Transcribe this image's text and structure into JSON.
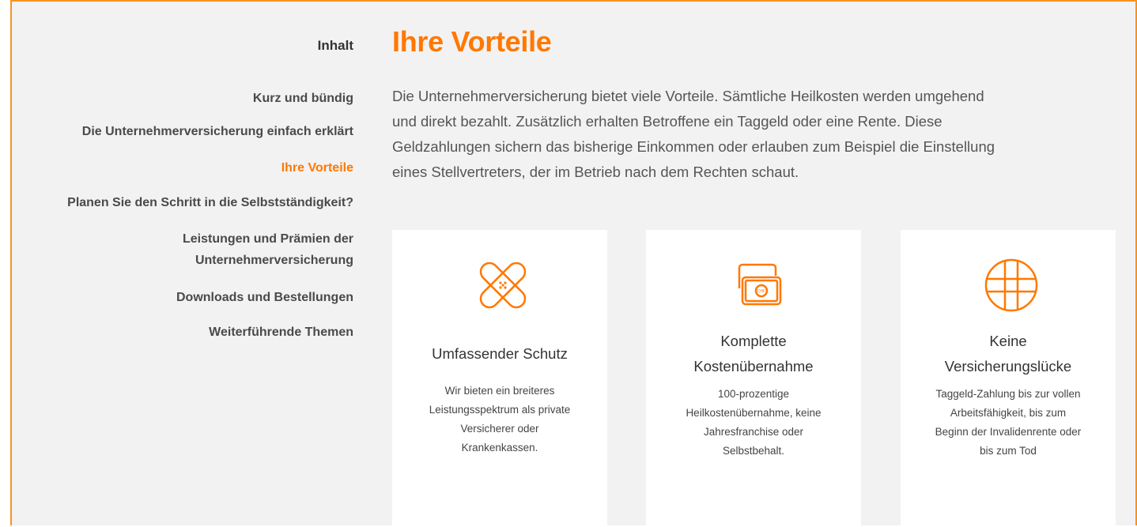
{
  "toc": {
    "title": "Inhalt",
    "items": [
      {
        "label": "Kurz und bündig"
      },
      {
        "label": "Die Unternehmerversicherung einfach erklärt"
      },
      {
        "label": "Ihre Vorteile",
        "active": true
      },
      {
        "label": "Planen Sie den Schritt in die Selbstständigkeit?"
      },
      {
        "label_line1": "Leistungen und Prämien der",
        "label_line2": "Unternehmerversicherung"
      },
      {
        "label": "Downloads und Bestellungen"
      },
      {
        "label": "Weiterführende Themen"
      }
    ]
  },
  "main": {
    "title": "Ihre Vorteile",
    "intro_lines": [
      "Die Unternehmerversicherung bietet viele Vorteile. Sämtliche Heilkosten werden umgehend",
      "und direkt bezahlt. Zusätzlich erhalten Betroffene ein Taggeld oder eine Rente. Diese",
      "Geldzahlungen sichern das bisherige Einkommen oder erlauben zum Beispiel die Einstellung",
      "eines Stellvertreters, der im Betrieb nach dem Rechten schaut."
    ]
  },
  "cards": [
    {
      "icon": "bandage-icon",
      "title_lines": [
        "Umfassender Schutz"
      ],
      "text_lines": [
        "Wir bieten ein breiteres",
        "Leistungsspektrum als private",
        "Versicherer oder",
        "Krankenkassen."
      ]
    },
    {
      "icon": "money-bills-icon",
      "icon_text": "CHF",
      "title_lines": [
        "Komplette",
        "Kostenübernahme"
      ],
      "text_lines": [
        "100-prozentige",
        "Heilkostenübernahme, keine",
        "Jahresfranchise oder",
        "Selbstbehalt."
      ]
    },
    {
      "icon": "safety-net-icon",
      "title_lines": [
        "Keine",
        "Versicherungslücke"
      ],
      "text_lines": [
        "Taggeld-Zahlung bis zur vollen",
        "Arbeitsfähigkeit, bis zum",
        "Beginn der Invalidenrente oder",
        "bis zum Tod"
      ]
    }
  ],
  "colors": {
    "accent": "#ff7800",
    "border": "#f7931e",
    "background": "#f2f2f2"
  }
}
